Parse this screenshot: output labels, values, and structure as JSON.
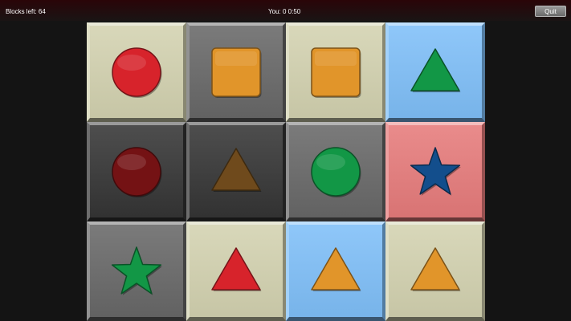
{
  "header": {
    "blocks_left_label": "Blocks left:",
    "blocks_left_value": "64",
    "player_label": "You:",
    "player_score": "0",
    "timer": "0:50",
    "quit_label": "Quit"
  },
  "colors": {
    "beige": "#d3d2b0",
    "gray": "#686868",
    "dark": "#353535",
    "blue": "#7fbff8",
    "pink": "#e67b7b",
    "red": "#d7232b",
    "orange": "#e1952a",
    "green": "#129746",
    "navy": "#134e8c",
    "dark_red": "#741214",
    "brown": "#6f4a1c"
  },
  "board": {
    "rows": [
      [
        {
          "tile": "beige",
          "shape": "circle-icon",
          "shape_color": "red"
        },
        {
          "tile": "gray",
          "shape": "square-icon",
          "shape_color": "orange"
        },
        {
          "tile": "beige",
          "shape": "square-icon",
          "shape_color": "orange"
        },
        {
          "tile": "blue",
          "shape": "triangle-icon",
          "shape_color": "green"
        }
      ],
      [
        {
          "tile": "dark",
          "shape": "circle-icon",
          "shape_color": "dark_red"
        },
        {
          "tile": "dark",
          "shape": "triangle-icon",
          "shape_color": "brown"
        },
        {
          "tile": "gray",
          "shape": "circle-icon",
          "shape_color": "green"
        },
        {
          "tile": "pink",
          "shape": "star-icon",
          "shape_color": "navy"
        }
      ],
      [
        {
          "tile": "gray",
          "shape": "star-icon",
          "shape_color": "green"
        },
        {
          "tile": "beige",
          "shape": "triangle-icon",
          "shape_color": "red"
        },
        {
          "tile": "blue",
          "shape": "triangle-icon",
          "shape_color": "orange"
        },
        {
          "tile": "beige",
          "shape": "triangle-icon",
          "shape_color": "orange"
        }
      ]
    ]
  }
}
